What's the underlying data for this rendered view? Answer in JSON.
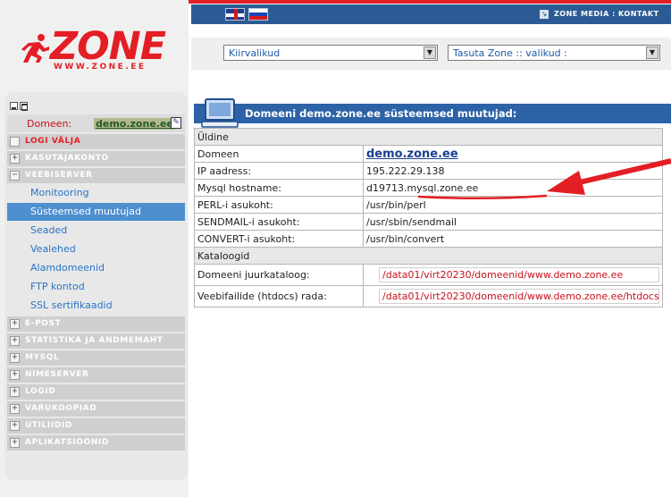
{
  "topbar": {
    "flags": [
      {
        "icon": "uk-flag-icon",
        "lang": "en"
      },
      {
        "icon": "ru-flag-icon",
        "lang": "ru"
      }
    ],
    "link_text": "ZONE MEDIA : KONTAKT"
  },
  "logo": {
    "word": "ZONE",
    "url": "WWW.ZONE.EE",
    "color": "#e31e24"
  },
  "sidebar": {
    "domain_label": "Domeen:",
    "domain_value": "demo.zone.ee",
    "logout": "LOGI VÄLJA",
    "sections_top": [
      {
        "label": "KASUTAJAKONTO",
        "expander": "+"
      },
      {
        "label": "VEEBISERVER",
        "expander": "−"
      }
    ],
    "subitems": [
      {
        "label": "Monitooring"
      },
      {
        "label": "Süsteemsed muutujad",
        "active": true
      },
      {
        "label": "Seaded"
      },
      {
        "label": "Vealehed"
      },
      {
        "label": "Alamdomeenid"
      },
      {
        "label": "FTP kontod"
      },
      {
        "label": "SSL sertifikaadid"
      }
    ],
    "sections_bottom": [
      {
        "label": "E-POST",
        "expander": "+"
      },
      {
        "label": "STATISTIKA JA ANDMEMAHT",
        "expander": "+"
      },
      {
        "label": "MYSQL",
        "expander": "+"
      },
      {
        "label": "NIMESERVER",
        "expander": "+"
      },
      {
        "label": "LOGID",
        "expander": "+"
      },
      {
        "label": "VARUKOOPIAD",
        "expander": "+"
      },
      {
        "label": "UTILIIDID",
        "expander": "+"
      },
      {
        "label": "APLIKATSIOONID",
        "expander": "+"
      }
    ]
  },
  "dropdowns": {
    "quick": "Kiirvalikud",
    "free": "Tasuta Zone :: valikud :"
  },
  "main": {
    "title": "Domeeni demo.zone.ee süsteemsed muutujad:",
    "general_section": "Üldine",
    "rows": [
      {
        "key": "Domeen",
        "value": "demo.zone.ee"
      },
      {
        "key": "IP aadress:",
        "value": "195.222.29.138"
      },
      {
        "key": "Mysql hostname:",
        "value": "d19713.mysql.zone.ee"
      },
      {
        "key": "PERL-i asukoht:",
        "value": "/usr/bin/perl"
      },
      {
        "key": "SENDMAIL-i asukoht:",
        "value": "/usr/sbin/sendmail"
      },
      {
        "key": "CONVERT-i asukoht:",
        "value": "/usr/bin/convert"
      }
    ],
    "catalog_section": "Kataloogid",
    "catalog_rows": [
      {
        "key": "Domeeni juurkataloog:",
        "value": "/data01/virt20230/domeenid/www.demo.zone.ee"
      },
      {
        "key": "Veebifailide (htdocs) rada:",
        "value": "/data01/virt20230/domeenid/www.demo.zone.ee/htdocs"
      }
    ]
  },
  "colors": {
    "brand_red": "#e31e24",
    "header_blue": "#2d62a6",
    "link_blue": "#2a73c6",
    "active_blue": "#4e8fd0"
  }
}
